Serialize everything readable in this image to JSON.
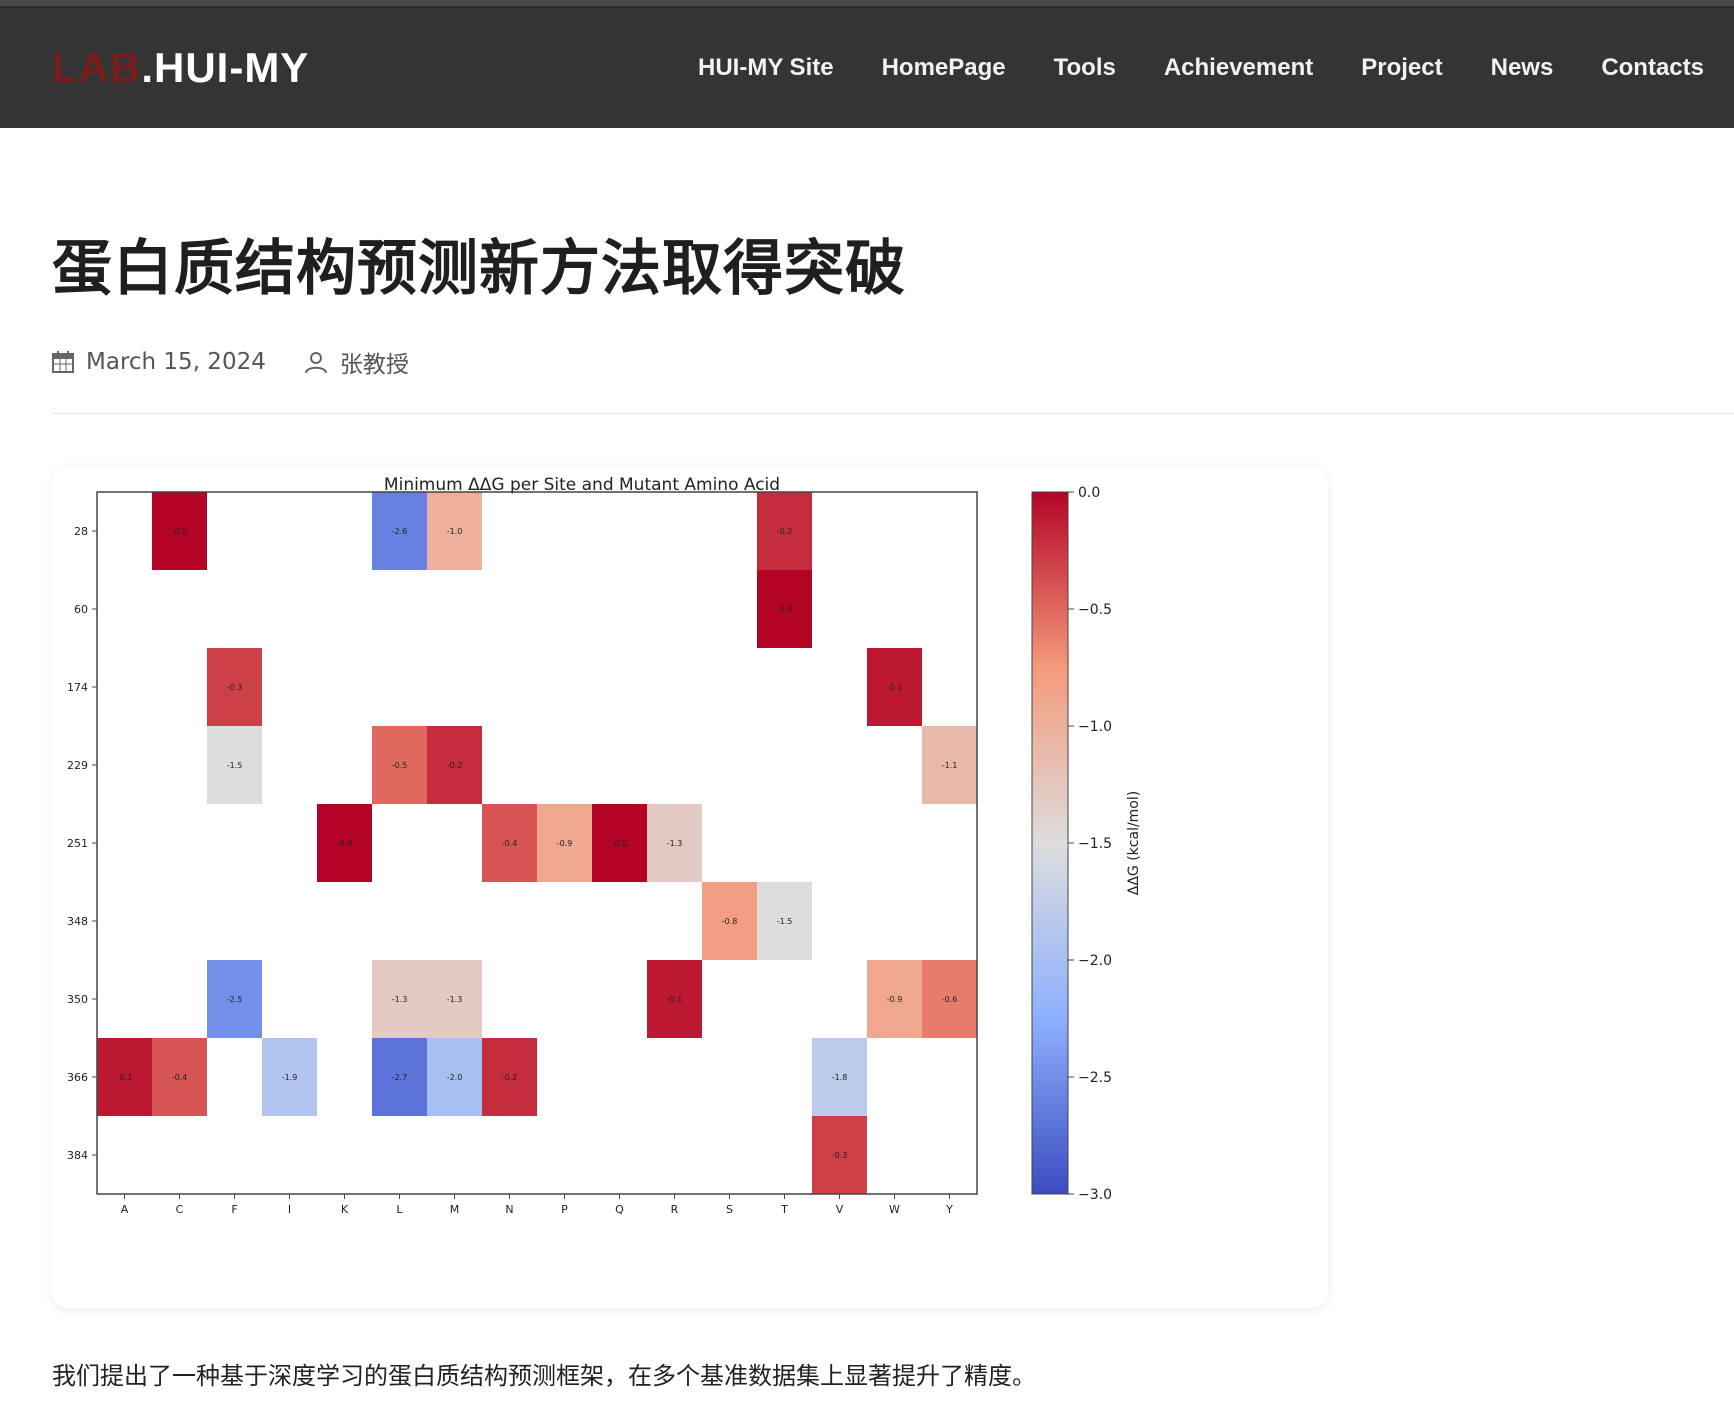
{
  "header": {
    "brand_prefix": "LAB",
    "brand_suffix": ".HUI-MY",
    "nav": [
      "HUI-MY Site",
      "HomePage",
      "Tools",
      "Achievement",
      "Project",
      "News",
      "Contacts"
    ]
  },
  "article": {
    "title": "蛋白质结构预测新方法取得突破",
    "date": "March 15, 2024",
    "author": "张教授",
    "body": "我们提出了一种基于深度学习的蛋白质结构预测框架，在多个基准数据集上显著提升了精度。"
  },
  "colors": {
    "navbar": "#343434",
    "brand_prefix": "#7a1c1c",
    "cmap_low": "#3b4cc0",
    "cmap_mid": "#dddddd",
    "cmap_high": "#b40426"
  },
  "icons": {
    "date": "calendar-icon",
    "author": "user-icon"
  },
  "chart_data": {
    "type": "heatmap",
    "title": "Minimum ΔΔG per Site and Mutant Amino Acid",
    "xlabel": "",
    "ylabel": "",
    "x_categories": [
      "A",
      "C",
      "F",
      "I",
      "K",
      "L",
      "M",
      "N",
      "P",
      "Q",
      "R",
      "S",
      "T",
      "V",
      "W",
      "Y"
    ],
    "y_categories": [
      "28",
      "60",
      "174",
      "229",
      "251",
      "348",
      "350",
      "366",
      "384"
    ],
    "colorbar": {
      "label": "ΔΔG (kcal/mol)",
      "vmin": -3.0,
      "vmax": 0.0,
      "ticks": [
        "0.0",
        "−0.5",
        "−1.0",
        "−1.5",
        "−2.0",
        "−2.5",
        "−3.0"
      ]
    },
    "cells": [
      {
        "row": "28",
        "col": "C",
        "value": -0.0,
        "label": "-0.0"
      },
      {
        "row": "28",
        "col": "L",
        "value": -2.6,
        "label": "-2.6"
      },
      {
        "row": "28",
        "col": "M",
        "value": -1.0,
        "label": "-1.0"
      },
      {
        "row": "28",
        "col": "T",
        "value": -0.2,
        "label": "-0.2"
      },
      {
        "row": "60",
        "col": "T",
        "value": -0.0,
        "label": "-0.0"
      },
      {
        "row": "174",
        "col": "F",
        "value": -0.3,
        "label": "-0.3"
      },
      {
        "row": "174",
        "col": "W",
        "value": -0.1,
        "label": "-0.1"
      },
      {
        "row": "229",
        "col": "F",
        "value": -1.5,
        "label": "-1.5"
      },
      {
        "row": "229",
        "col": "L",
        "value": -0.5,
        "label": "-0.5"
      },
      {
        "row": "229",
        "col": "M",
        "value": -0.2,
        "label": "-0.2"
      },
      {
        "row": "229",
        "col": "Y",
        "value": -1.1,
        "label": "-1.1"
      },
      {
        "row": "251",
        "col": "K",
        "value": -0.0,
        "label": "-0.0"
      },
      {
        "row": "251",
        "col": "N",
        "value": -0.4,
        "label": "-0.4"
      },
      {
        "row": "251",
        "col": "P",
        "value": -0.9,
        "label": "-0.9"
      },
      {
        "row": "251",
        "col": "Q",
        "value": -0.0,
        "label": "-0.0"
      },
      {
        "row": "251",
        "col": "R",
        "value": -1.3,
        "label": "-1.3"
      },
      {
        "row": "348",
        "col": "S",
        "value": -0.8,
        "label": "-0.8"
      },
      {
        "row": "348",
        "col": "T",
        "value": -1.5,
        "label": "-1.5"
      },
      {
        "row": "350",
        "col": "F",
        "value": -2.5,
        "label": "-2.5"
      },
      {
        "row": "350",
        "col": "L",
        "value": -1.3,
        "label": "-1.3"
      },
      {
        "row": "350",
        "col": "M",
        "value": -1.3,
        "label": "-1.3"
      },
      {
        "row": "350",
        "col": "R",
        "value": -0.1,
        "label": "-0.1"
      },
      {
        "row": "350",
        "col": "W",
        "value": -0.9,
        "label": "-0.9"
      },
      {
        "row": "350",
        "col": "Y",
        "value": -0.6,
        "label": "-0.6"
      },
      {
        "row": "366",
        "col": "A",
        "value": -0.1,
        "label": "-0.1"
      },
      {
        "row": "366",
        "col": "C",
        "value": -0.4,
        "label": "-0.4"
      },
      {
        "row": "366",
        "col": "I",
        "value": -1.9,
        "label": "-1.9"
      },
      {
        "row": "366",
        "col": "L",
        "value": -2.7,
        "label": "-2.7"
      },
      {
        "row": "366",
        "col": "M",
        "value": -2.0,
        "label": "-2.0"
      },
      {
        "row": "366",
        "col": "N",
        "value": -0.2,
        "label": "-0.2"
      },
      {
        "row": "366",
        "col": "V",
        "value": -1.8,
        "label": "-1.8"
      },
      {
        "row": "384",
        "col": "V",
        "value": -0.3,
        "label": "-0.3"
      }
    ]
  }
}
